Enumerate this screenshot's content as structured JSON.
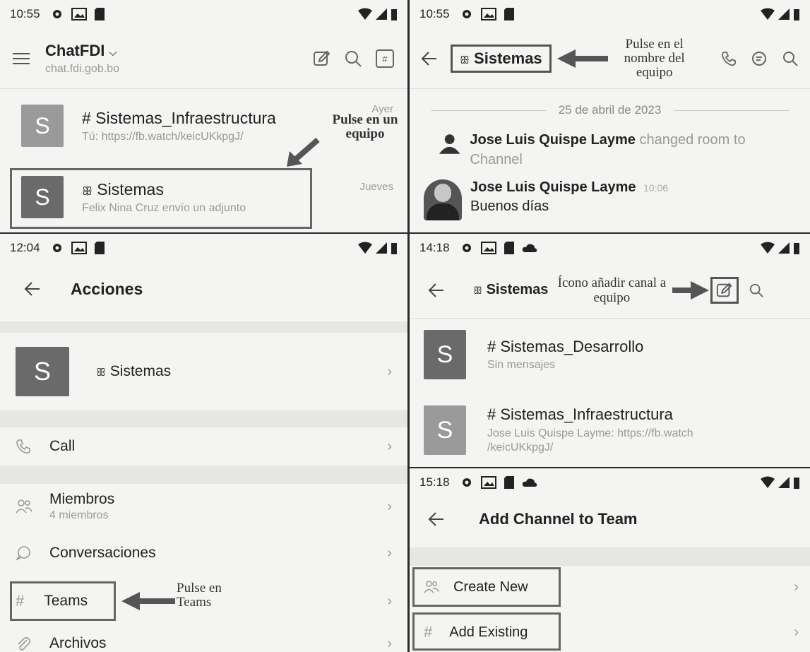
{
  "panel1": {
    "status_time": "10:55",
    "app_title": "ChatFDI",
    "app_subtitle": "chat.fdi.gob.bo",
    "chats": [
      {
        "avatar": "S",
        "name": "# Sistemas_Infraestructura",
        "preview": "Tú: https://fb.watch/keicUKkpgJ/",
        "time": "Ayer"
      },
      {
        "avatar": "S",
        "name": "Sistemas",
        "preview": "Felix Nina Cruz envío un adjunto",
        "time": "Jueves"
      }
    ],
    "annotation": "Pulse en un equipo"
  },
  "panel2": {
    "status_time": "10:55",
    "title": "Sistemas",
    "annotation": "Pulse en el nombre del equipo",
    "date_divider": "25 de abril de 2023",
    "messages": [
      {
        "author": "Jose Luis Quispe Layme",
        "text": "changed room to Channel",
        "time": ""
      },
      {
        "author": "Jose Luis Quispe Layme",
        "text": "Buenos días",
        "time": "10:06"
      }
    ]
  },
  "panel3": {
    "status_time": "12:04",
    "title": "Acciones",
    "team": {
      "avatar": "S",
      "name": "Sistemas"
    },
    "items": [
      {
        "label": "Call",
        "sub": ""
      },
      {
        "label": "Miembros",
        "sub": "4 miembros"
      },
      {
        "label": "Conversaciones",
        "sub": ""
      },
      {
        "label": "Teams",
        "sub": ""
      },
      {
        "label": "Archivos",
        "sub": ""
      }
    ],
    "annotation": "Pulse en Teams"
  },
  "panel4": {
    "status_time": "14:18",
    "title": "Sistemas",
    "annotation": "Ícono añadir canal a equipo",
    "channels": [
      {
        "avatar": "S",
        "name": "Sistemas_Desarrollo",
        "preview": "Sin mensajes"
      },
      {
        "avatar": "S",
        "name": "# Sistemas_Infraestructura",
        "preview": "Jose Luis Quispe Layme: https://fb.watch /keicUKkpgJ/"
      }
    ]
  },
  "panel5": {
    "status_time": "15:18",
    "title": "Add Channel to Team",
    "items": [
      {
        "label": "Create New"
      },
      {
        "label": "Add Existing"
      }
    ]
  }
}
